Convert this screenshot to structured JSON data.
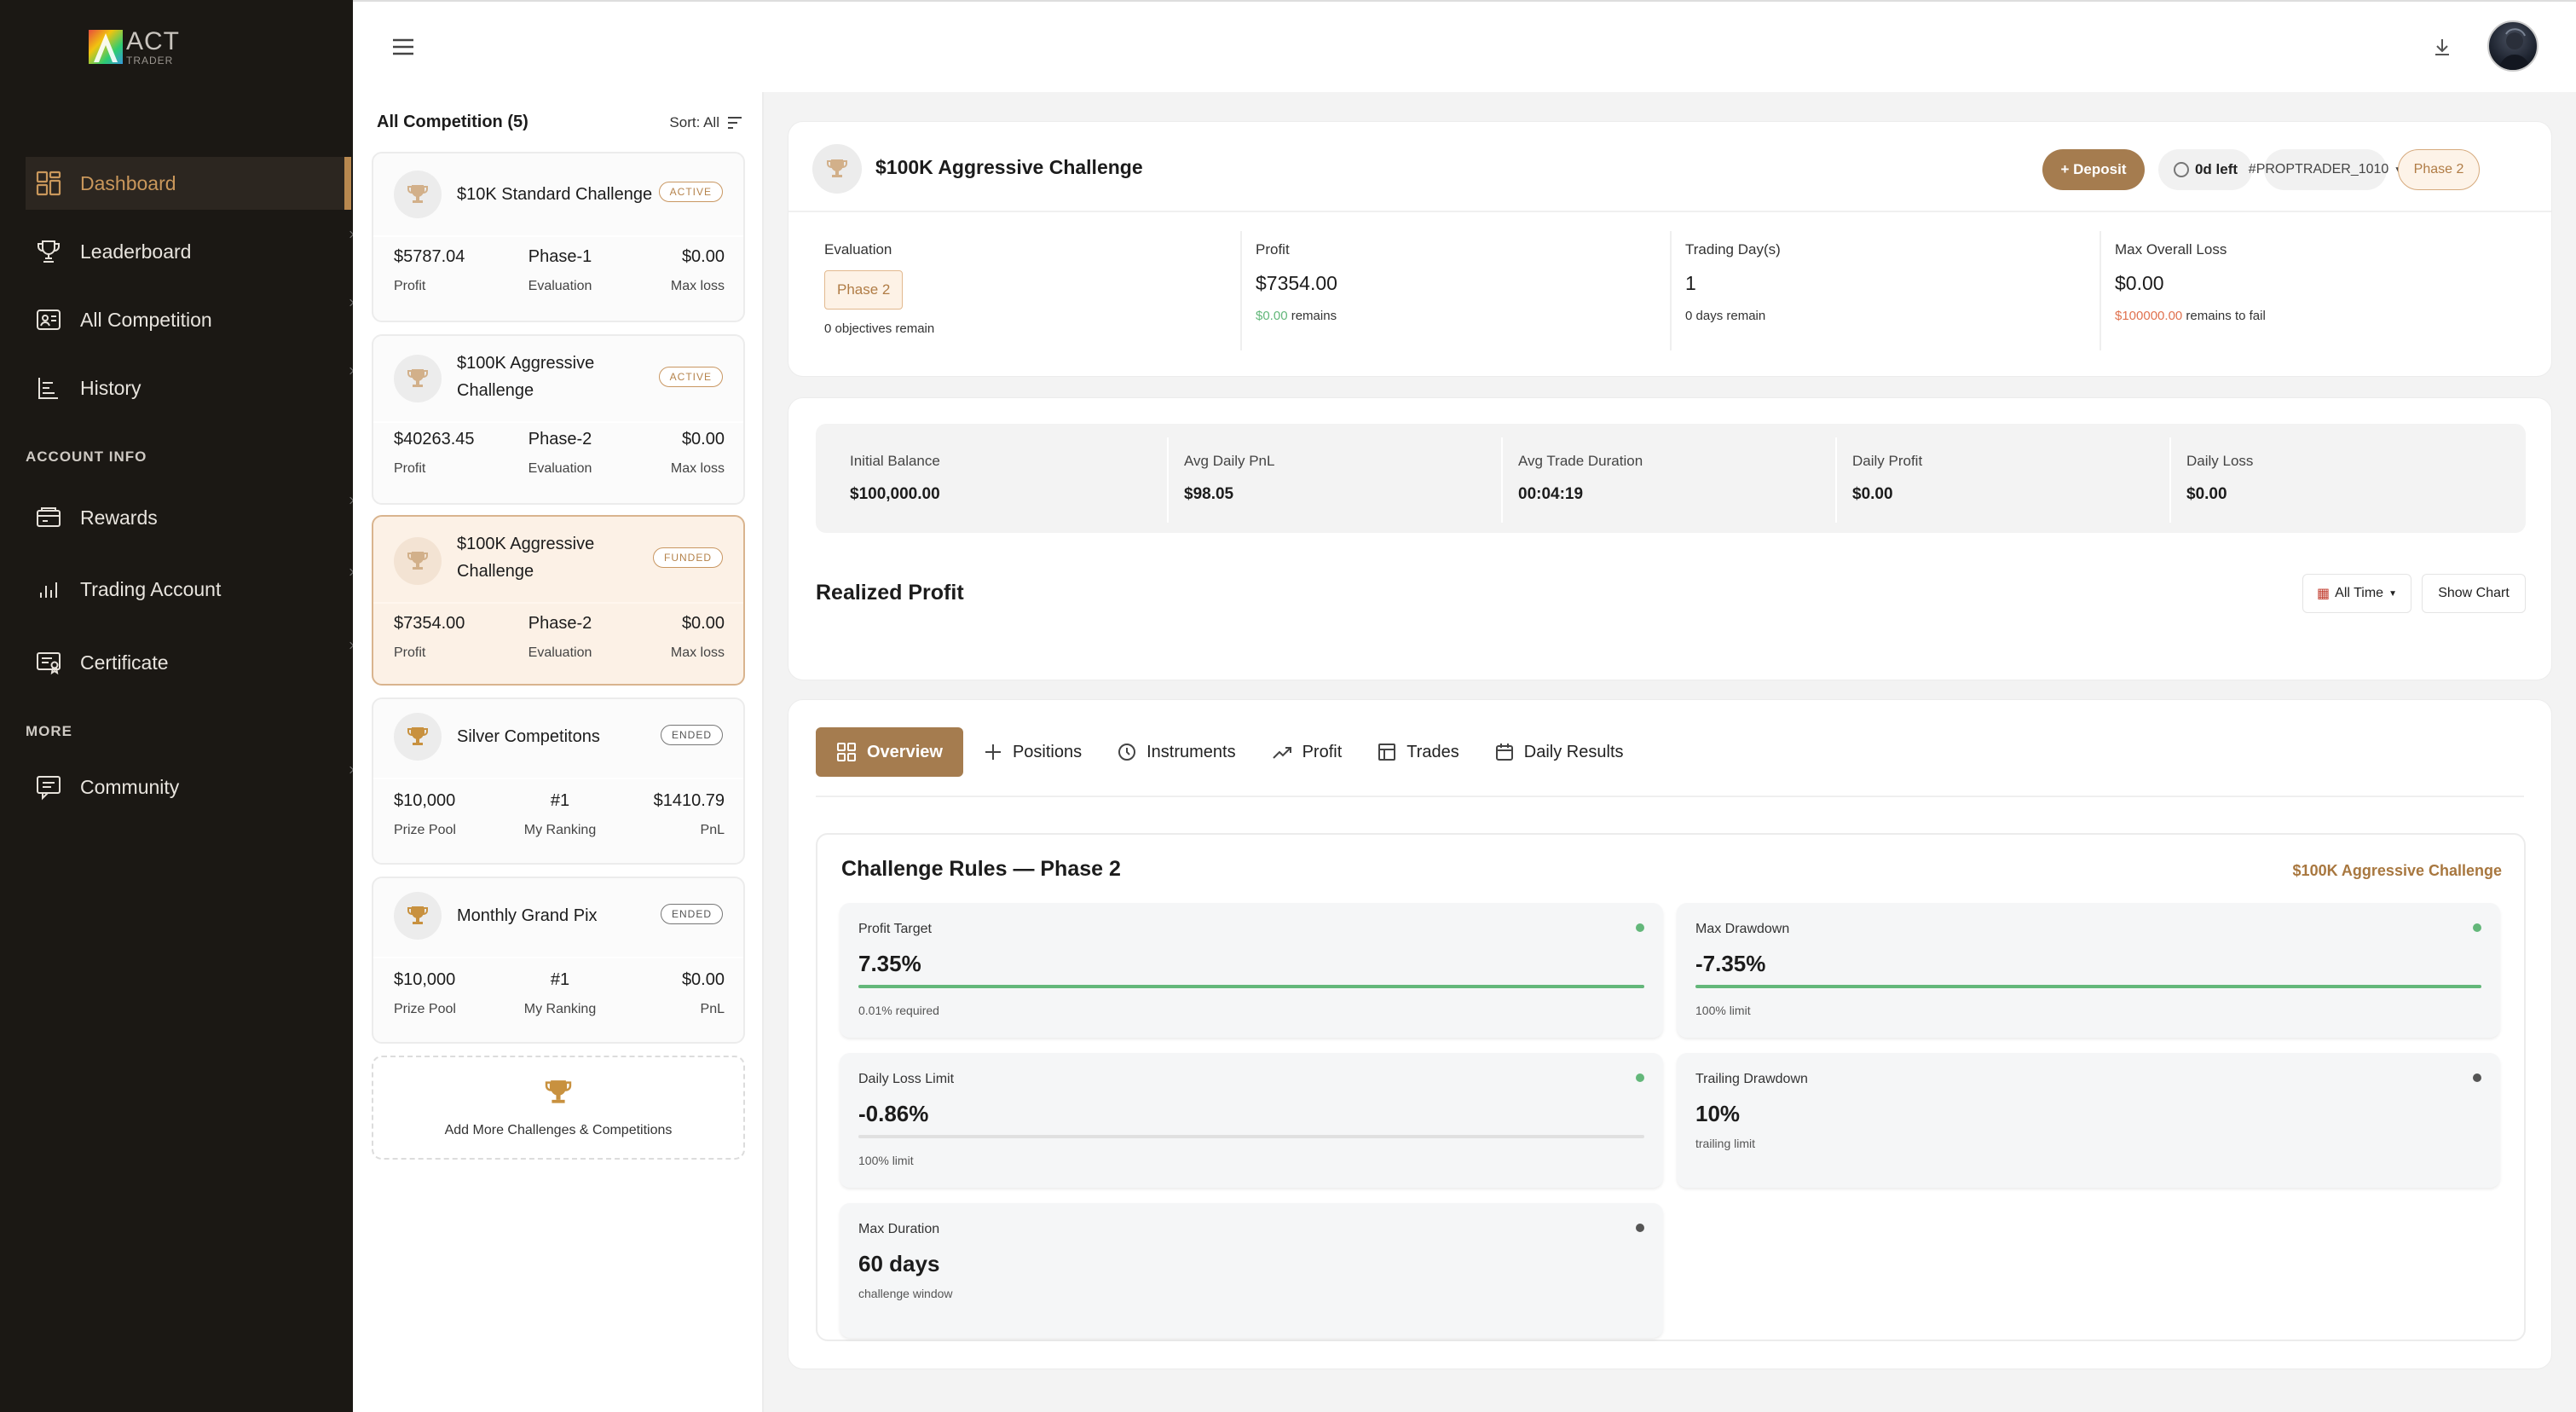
{
  "brand": {
    "name": "ACT",
    "tag": "TRADER"
  },
  "sidebar": {
    "items": [
      {
        "label": "Dashboard",
        "icon": "dashboard-icon",
        "active": true
      },
      {
        "label": "Leaderboard",
        "icon": "trophy-icon"
      },
      {
        "label": "All Competition",
        "icon": "competition-icon"
      },
      {
        "label": "History",
        "icon": "history-icon"
      }
    ],
    "account_label": "ACCOUNT INFO",
    "account_items": [
      {
        "label": "Rewards",
        "icon": "rewards-icon"
      },
      {
        "label": "Trading Account",
        "icon": "bar-chart-icon"
      },
      {
        "label": "Certificate",
        "icon": "certificate-icon"
      }
    ],
    "more_label": "MORE",
    "more_items": [
      {
        "label": "Community",
        "icon": "chat-icon"
      }
    ]
  },
  "competitions": {
    "title": "All Competition (5)",
    "sort_label": "Sort: All",
    "cards": [
      {
        "name": "$10K Standard Challenge",
        "badge": "ACTIVE",
        "stats": [
          {
            "v": "$5787.04",
            "l": "Profit"
          },
          {
            "v": "Phase-1",
            "l": "Evaluation"
          },
          {
            "v": "$0.00",
            "l": "Max loss"
          }
        ]
      },
      {
        "name": "$100K Aggressive Challenge",
        "badge": "ACTIVE",
        "stats": [
          {
            "v": "$40263.45",
            "l": "Profit"
          },
          {
            "v": "Phase-2",
            "l": "Evaluation"
          },
          {
            "v": "$0.00",
            "l": "Max loss"
          }
        ]
      },
      {
        "name": "$100K Aggressive Challenge",
        "badge": "FUNDED",
        "stats": [
          {
            "v": "$7354.00",
            "l": "Profit"
          },
          {
            "v": "Phase-2",
            "l": "Evaluation"
          },
          {
            "v": "$0.00",
            "l": "Max loss"
          }
        ]
      },
      {
        "name": "Silver Competitons",
        "badge": "ENDED",
        "stats": [
          {
            "v": "$10,000",
            "l": "Prize Pool"
          },
          {
            "v": "#1",
            "l": "My Ranking"
          },
          {
            "v": "$1410.79",
            "l": "PnL"
          }
        ]
      },
      {
        "name": "Monthly Grand Pix",
        "badge": "ENDED",
        "stats": [
          {
            "v": "$10,000",
            "l": "Prize Pool"
          },
          {
            "v": "#1",
            "l": "My Ranking"
          },
          {
            "v": "$0.00",
            "l": "PnL"
          }
        ]
      }
    ],
    "add_label": "Add More Challenges & Competitions"
  },
  "header": {
    "title": "$100K Aggressive Challenge",
    "deposit": "+ Deposit",
    "days_left": "0d left",
    "account": "#PROPTRADER_1010",
    "phase": "Phase 2"
  },
  "summary": {
    "evaluation": {
      "label": "Evaluation",
      "value": "Phase 2",
      "sub": "0 objectives remain"
    },
    "profit": {
      "label": "Profit",
      "value": "$7354.00",
      "sub_value": "$0.00",
      "sub_text": "remains"
    },
    "trading_days": {
      "label": "Trading Day(s)",
      "value": "1",
      "sub": "0 days remain"
    },
    "max_loss": {
      "label": "Max Overall Loss",
      "value": "$0.00",
      "sub_value": "$100000.00",
      "sub_text": "remains to fail"
    }
  },
  "metrics": [
    {
      "label": "Initial Balance",
      "value": "$100,000.00"
    },
    {
      "label": "Avg Daily PnL",
      "value": "$98.05"
    },
    {
      "label": "Avg Trade Duration",
      "value": "00:04:19"
    },
    {
      "label": "Daily Profit",
      "value": "$0.00"
    },
    {
      "label": "Daily Loss",
      "value": "$0.00"
    }
  ],
  "realized": {
    "title": "Realized Profit",
    "range": "All Time",
    "show_chart": "Show Chart"
  },
  "tabs": [
    {
      "label": "Overview",
      "icon": "grid-icon"
    },
    {
      "label": "Positions",
      "icon": "plus-icon"
    },
    {
      "label": "Instruments",
      "icon": "clock-icon"
    },
    {
      "label": "Profit",
      "icon": "trend-icon"
    },
    {
      "label": "Trades",
      "icon": "table-icon"
    },
    {
      "label": "Daily Results",
      "icon": "calendar-icon"
    }
  ],
  "rules": {
    "title": "Challenge Rules — Phase 2",
    "subtitle": "$100K Aggressive Challenge",
    "items": [
      {
        "label": "Profit Target",
        "value": "7.35%",
        "sub": "0.01% required",
        "progress": 1.0,
        "status_color": "#63b77a"
      },
      {
        "label": "Max Drawdown",
        "value": "-7.35%",
        "sub": "100% limit",
        "progress": 1.0,
        "status_color": "#63b77a"
      },
      {
        "label": "Daily Loss Limit",
        "value": "-0.86%",
        "sub": "100% limit",
        "progress": 0.0,
        "status_color": "#63b77a"
      },
      {
        "label": "Trailing Drawdown",
        "value": "10%",
        "sub": "trailing limit",
        "status_color": "#555555"
      },
      {
        "label": "Max Duration",
        "value": "60 days",
        "sub": "challenge window",
        "status_color": "#555555"
      }
    ]
  },
  "colors": {
    "accent": "#a57c4f",
    "sidebar_bg": "#1b1814",
    "success": "#63b77a",
    "danger": "#e0724f"
  }
}
